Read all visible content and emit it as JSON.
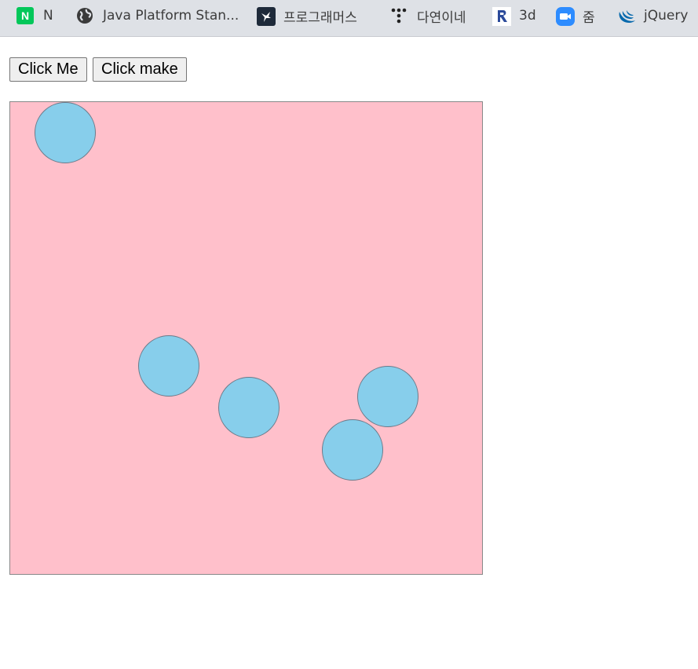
{
  "bookmarks_bar": {
    "items": [
      {
        "icon": "naver-n-icon",
        "icon_text": "N",
        "label": "N"
      },
      {
        "icon": "globe-icon",
        "label": "Java Platform Stan..."
      },
      {
        "icon": "programmers-icon",
        "label": "프로그래머스"
      },
      {
        "icon": "dots-icon",
        "label": "다연이네"
      },
      {
        "icon": "repo-icon",
        "label": "3d"
      },
      {
        "icon": "zoom-icon",
        "label": "줌"
      },
      {
        "icon": "jquery-icon",
        "label": "jQuery"
      }
    ]
  },
  "buttons": {
    "click_me": "Click Me",
    "click_make": "Click make"
  },
  "canvas": {
    "background": "#ffc0cb",
    "circle_color": "#87ceeb",
    "circle_count": 5
  },
  "colors": {
    "bookmarks_bar": "#dee1e6",
    "naver": "#03c75a",
    "zoom": "#2d8cff",
    "jquery": "#0769ad"
  }
}
